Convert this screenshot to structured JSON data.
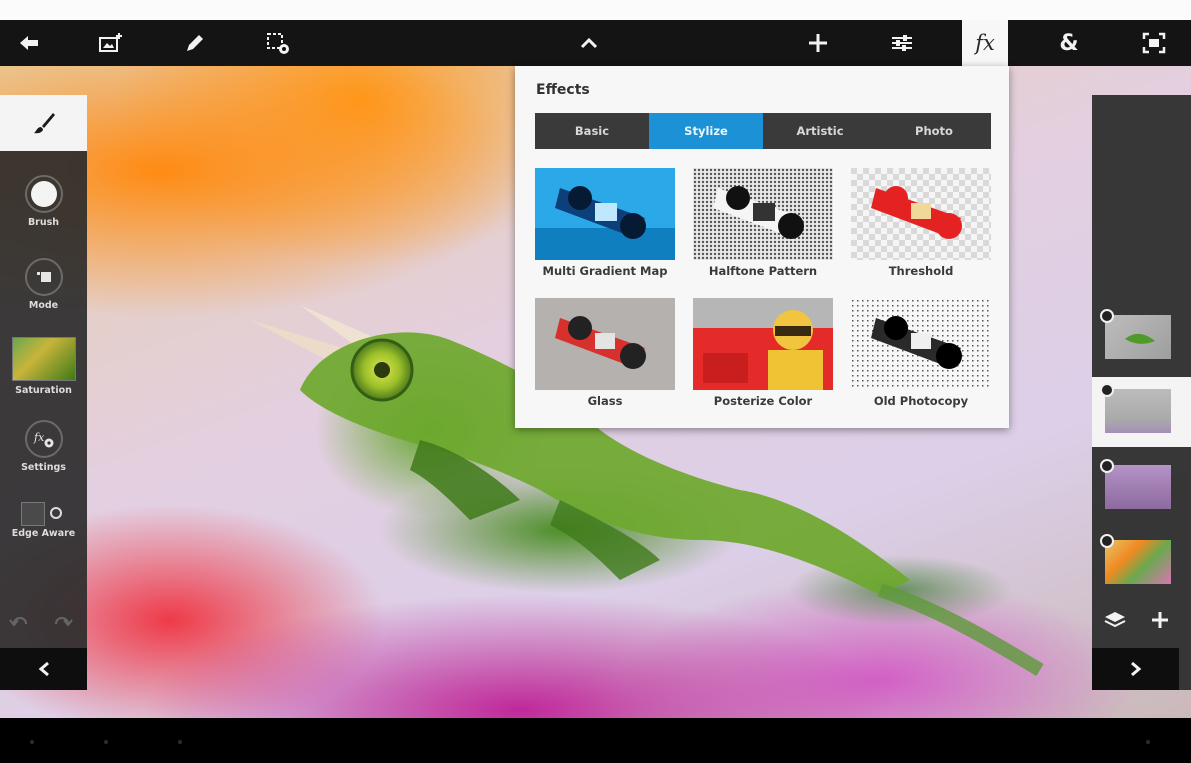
{
  "topbar": {
    "icons": [
      "back-arrow-icon",
      "add-image-icon",
      "pencil-icon",
      "selection-settings-icon",
      "chevron-up-icon",
      "plus-icon",
      "adjustments-icon",
      "fx-icon",
      "ampersand-icon",
      "fit-screen-icon"
    ],
    "fx_label": "fx",
    "amp_label": "&"
  },
  "effects": {
    "title": "Effects",
    "tabs": [
      {
        "label": "Basic",
        "active": false
      },
      {
        "label": "Stylize",
        "active": true
      },
      {
        "label": "Artistic",
        "active": false
      },
      {
        "label": "Photo",
        "active": false
      }
    ],
    "tiles": [
      {
        "label": "Multi Gradient Map"
      },
      {
        "label": "Halftone Pattern"
      },
      {
        "label": "Threshold"
      },
      {
        "label": "Glass"
      },
      {
        "label": "Posterize Color"
      },
      {
        "label": "Old Photocopy"
      }
    ]
  },
  "left_panel": {
    "tools": [
      {
        "label": "Brush"
      },
      {
        "label": "Mode"
      },
      {
        "label": "Saturation"
      },
      {
        "label": "Settings"
      },
      {
        "label": "Edge Aware"
      }
    ],
    "edge_aware_on": false
  },
  "right_panel": {
    "layers": [
      {
        "name": "chameleon-layer",
        "selected": false
      },
      {
        "name": "gray-layer",
        "selected": true
      },
      {
        "name": "purple-layer",
        "selected": false
      },
      {
        "name": "flower-layer",
        "selected": false
      }
    ]
  },
  "colors": {
    "accent": "#1c91d6",
    "toolbar": "#141414",
    "panel": "#2c2c2c"
  }
}
